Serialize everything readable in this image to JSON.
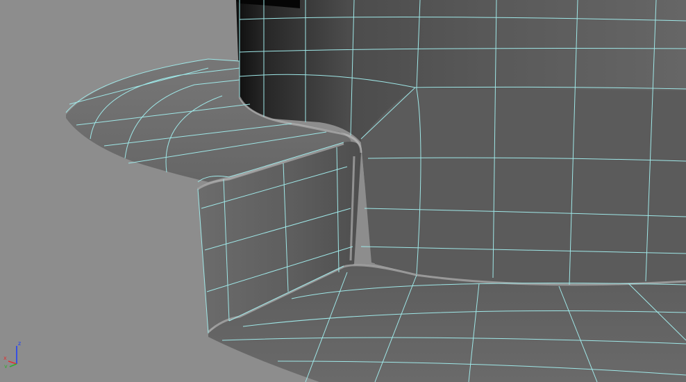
{
  "viewport": {
    "background_color": "#8d8d8d",
    "wire_color": "#9fe8e8",
    "mesh": "subdivided-polygon-mesh"
  },
  "axis_gizmo": {
    "labels": {
      "z": "z",
      "x": "x",
      "y": "y"
    },
    "colors": {
      "z": "#1a3cff",
      "x": "#e03030",
      "y": "#2fae2f"
    }
  }
}
